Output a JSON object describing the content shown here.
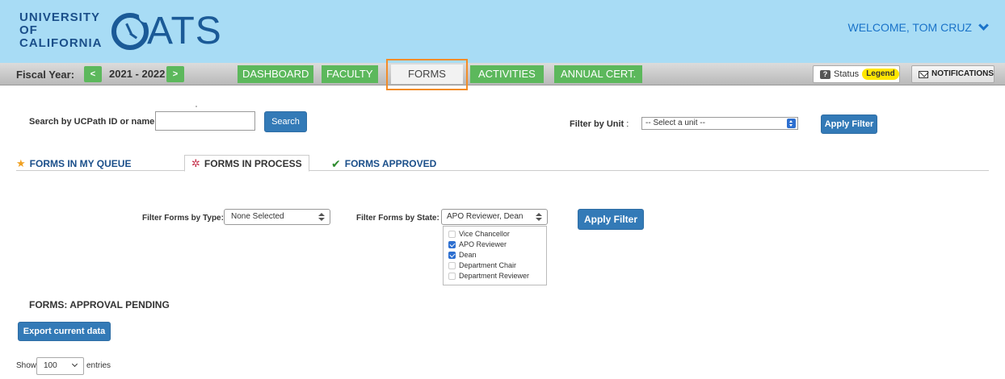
{
  "header": {
    "uc_logo_lines": [
      "UNIVERSITY",
      "OF",
      "CALIFORNIA"
    ],
    "app_logo_text": "ATS",
    "welcome": "WELCOME, TOM CRUZ"
  },
  "navbar": {
    "fiscal_label": "Fiscal Year:",
    "prev_label": "<",
    "fiscal_value": "2021 - 2022",
    "next_label": ">",
    "tabs": [
      {
        "label": "DASHBOARD"
      },
      {
        "label": "FACULTY"
      },
      {
        "label": "FORMS"
      },
      {
        "label": "ACTIVITIES"
      },
      {
        "label": "ANNUAL CERT."
      }
    ],
    "active_tab": "FORMS",
    "status_label": "Status",
    "legend_label": "Legend",
    "notifications_label": "NOTIFICATIONS"
  },
  "search": {
    "label": "Search by UCPath ID or name:",
    "value": "",
    "button": "Search"
  },
  "unit_filter": {
    "label": "Filter by Unit",
    "colon": " :",
    "selected": "-- Select a unit --",
    "button": "Apply Filter"
  },
  "subtabs": [
    {
      "label": "FORMS IN MY QUEUE",
      "icon": "star-icon"
    },
    {
      "label": "FORMS IN PROCESS",
      "icon": "gear-icon"
    },
    {
      "label": "FORMS APPROVED",
      "icon": "check-icon"
    }
  ],
  "filters": {
    "type_label": "Filter Forms by Type:",
    "type_selected": "None Selected",
    "state_label": "Filter Forms by State:",
    "state_selected": "APO Reviewer, Dean",
    "state_options": [
      {
        "label": "Vice Chancellor",
        "checked": false
      },
      {
        "label": "APO Reviewer",
        "checked": true
      },
      {
        "label": "Dean",
        "checked": true
      },
      {
        "label": "Department Chair",
        "checked": false
      },
      {
        "label": "Department Reviewer",
        "checked": false
      }
    ],
    "apply_button": "Apply Filter"
  },
  "section": {
    "title": "FORMS: APPROVAL PENDING",
    "export_button": "Export current data",
    "show_label": "Show",
    "entries_value": "100",
    "entries_label": "entries"
  },
  "colors": {
    "header_bg": "#a8dcf5",
    "nav_green": "#5cb85c",
    "primary_blue": "#337ab7",
    "highlight_orange": "#f28c28",
    "legend_yellow": "#ffe600"
  }
}
